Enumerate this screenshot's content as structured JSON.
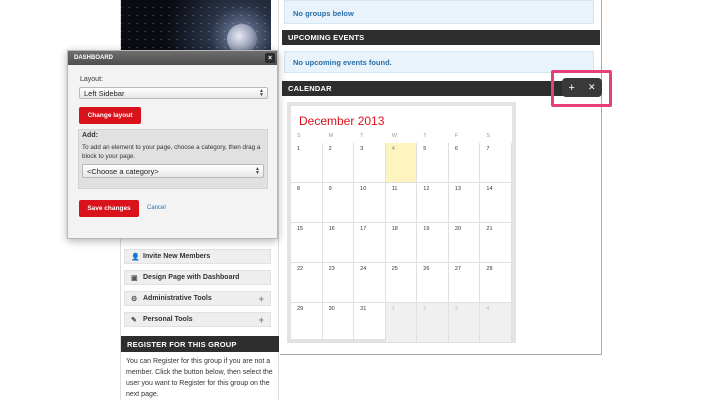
{
  "groups_notice": "No groups below",
  "upcoming_events": {
    "title": "UPCOMING EVENTS",
    "empty_text": "No upcoming events found."
  },
  "calendar": {
    "section_title": "CALENDAR",
    "month_label": "December 2013",
    "weekdays": [
      "S",
      "M",
      "T",
      "W",
      "T",
      "F",
      "S"
    ],
    "weeks": [
      [
        "1",
        "2",
        "3",
        "4",
        "5",
        "6",
        "7"
      ],
      [
        "8",
        "9",
        "10",
        "11",
        "12",
        "13",
        "14"
      ],
      [
        "15",
        "16",
        "17",
        "18",
        "19",
        "20",
        "21"
      ],
      [
        "22",
        "23",
        "24",
        "25",
        "26",
        "27",
        "28"
      ],
      [
        "29",
        "30",
        "31",
        "1",
        "2",
        "3",
        "4"
      ]
    ],
    "today": "4",
    "toolbar": {
      "add_icon": "+",
      "close_icon": "✕"
    }
  },
  "dashboard": {
    "title": "DASHBOARD",
    "close_icon": "×",
    "layout_label": "Layout:",
    "layout_value": "Left Sidebar",
    "change_layout_button": "Change layout",
    "add_label": "Add:",
    "add_help": "To add an element to your page, choose a category, then drag a block to your page.",
    "category_value": "<Choose a category>",
    "save_button": "Save changes",
    "cancel_link": "Cancel"
  },
  "sidebar": {
    "items": [
      {
        "label": "Invite New Members",
        "icon": "user-icon",
        "glyph": "👤",
        "expandable": false
      },
      {
        "label": "Design Page with Dashboard",
        "icon": "dashboard-icon",
        "glyph": "▣",
        "expandable": false
      },
      {
        "label": "Administrative Tools",
        "icon": "gear-icon",
        "glyph": "⚙",
        "expandable": true
      },
      {
        "label": "Personal Tools",
        "icon": "tools-icon",
        "glyph": "✎",
        "expandable": true
      }
    ],
    "plus_glyph": "+"
  },
  "register": {
    "title": "REGISTER FOR THIS GROUP",
    "text": "You can Register for this group if you are not a member. Click the button below, then select the user you want to Register for this group on the next page."
  },
  "colors": {
    "accent_red": "#d9121b",
    "highlight_pink": "#e83e79",
    "header_dark": "#2e2e2e",
    "link_blue": "#2a6fa8"
  }
}
